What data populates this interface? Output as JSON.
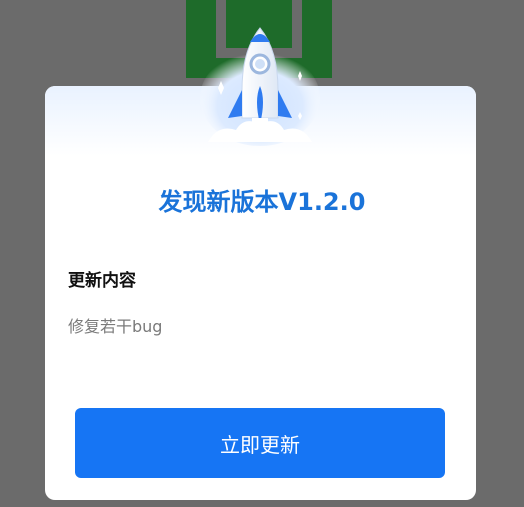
{
  "dialog": {
    "title": "发现新版本V1.2.0",
    "section_label": "更新内容",
    "content": "修复若干bug",
    "button_label": "立即更新"
  },
  "icons": {
    "hero": "rocket-icon"
  },
  "colors": {
    "overlay": "#6b6b6b",
    "background_logo": "#1e6b2a",
    "title": "#1a73d9",
    "primary_button": "#1675f4",
    "card_background": "#ffffff"
  }
}
